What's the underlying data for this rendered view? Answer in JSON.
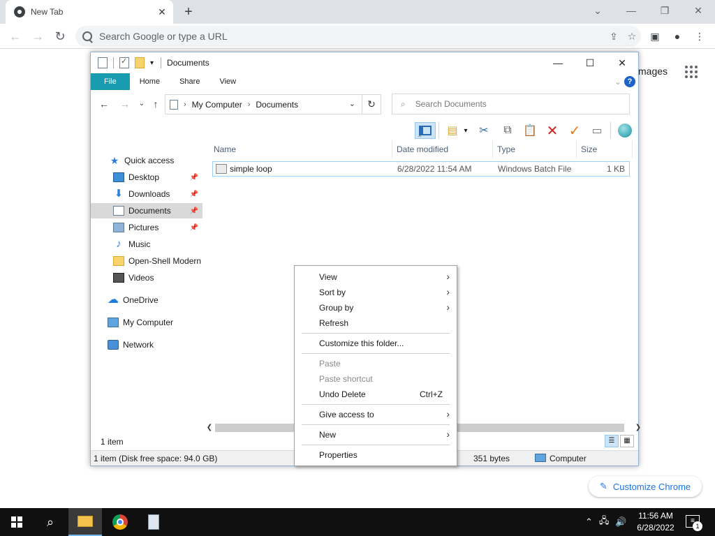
{
  "chrome": {
    "tab_title": "New Tab",
    "tab_close": "✕",
    "new_tab": "+",
    "min": "⌄",
    "minimize": "—",
    "restore": "❐",
    "close": "✕",
    "omnibox_placeholder": "Search Google or type a URL",
    "images_link": "mages",
    "customize_label": "Customize Chrome"
  },
  "explorer": {
    "title": "Documents",
    "ribbon_tabs": [
      "File",
      "Home",
      "Share",
      "View"
    ],
    "breadcrumb": [
      "My Computer",
      "Documents"
    ],
    "search_placeholder": "Search Documents",
    "nav_items": [
      {
        "label": "Quick access",
        "icon": "star-icon"
      },
      {
        "label": "Desktop",
        "icon": "desktop-icon",
        "pinned": true
      },
      {
        "label": "Downloads",
        "icon": "download-icon",
        "pinned": true
      },
      {
        "label": "Documents",
        "icon": "documents-icon",
        "pinned": true,
        "selected": true
      },
      {
        "label": "Pictures",
        "icon": "pictures-icon",
        "pinned": true
      },
      {
        "label": "Music",
        "icon": "music-icon"
      },
      {
        "label": "Open-Shell Modern",
        "icon": "folder-icon"
      },
      {
        "label": "Videos",
        "icon": "videos-icon"
      },
      {
        "label": "OneDrive",
        "icon": "onedrive-icon"
      },
      {
        "label": "My Computer",
        "icon": "computer-icon"
      },
      {
        "label": "Network",
        "icon": "network-icon"
      }
    ],
    "columns": [
      "Name",
      "Date modified",
      "Type",
      "Size"
    ],
    "files": [
      {
        "name": "simple loop",
        "date": "6/28/2022 11:54 AM",
        "type": "Windows Batch File",
        "size": "1 KB"
      }
    ],
    "item_count": "1 item",
    "status_disk": "1 item (Disk free space: 94.0 GB)",
    "status_bytes": "351 bytes",
    "status_location": "Computer"
  },
  "context_menu": {
    "items": [
      {
        "label": "View",
        "submenu": true
      },
      {
        "label": "Sort by",
        "submenu": true
      },
      {
        "label": "Group by",
        "submenu": true
      },
      {
        "label": "Refresh"
      },
      {
        "label": "Customize this folder..."
      },
      {
        "label": "Paste",
        "disabled": true
      },
      {
        "label": "Paste shortcut",
        "disabled": true
      },
      {
        "label": "Undo Delete",
        "shortcut": "Ctrl+Z"
      },
      {
        "label": "Give access to",
        "submenu": true
      },
      {
        "label": "New",
        "submenu": true
      },
      {
        "label": "Properties"
      }
    ]
  },
  "taskbar": {
    "time": "11:56 AM",
    "date": "6/28/2022",
    "notifications": "1"
  }
}
